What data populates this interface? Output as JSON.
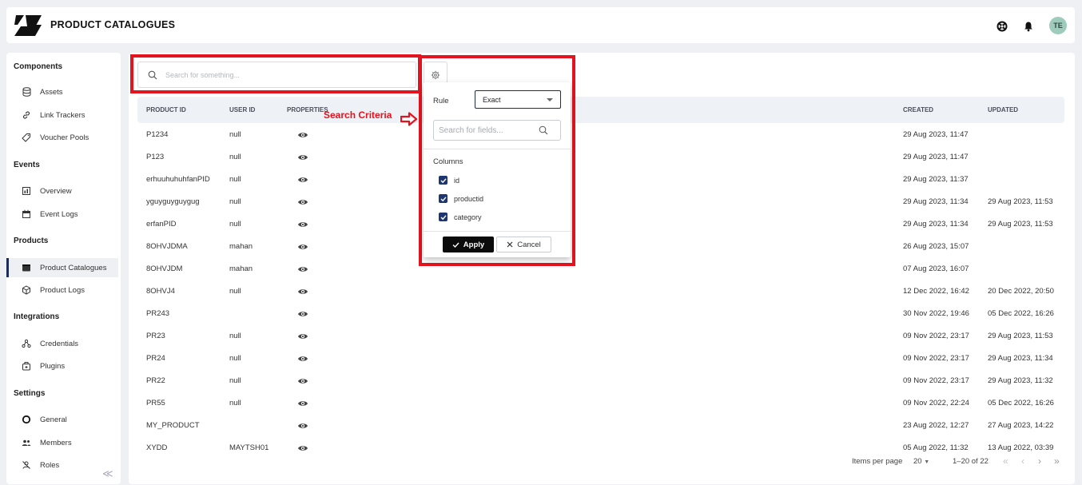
{
  "header": {
    "title": "PRODUCT CATALOGUES",
    "avatar": "TE"
  },
  "sidebar": {
    "sections": [
      {
        "title": "Components",
        "items": [
          "Assets",
          "Link Trackers",
          "Voucher Pools"
        ]
      },
      {
        "title": "Events",
        "items": [
          "Overview",
          "Event Logs"
        ]
      },
      {
        "title": "Products",
        "items": [
          "Product Catalogues",
          "Product Logs"
        ]
      },
      {
        "title": "Integrations",
        "items": [
          "Credentials",
          "Plugins"
        ]
      },
      {
        "title": "Settings",
        "items": [
          "General",
          "Members",
          "Roles"
        ]
      }
    ],
    "active_item": "Product Catalogues",
    "collapse_glyph": "≪"
  },
  "search": {
    "placeholder": "Search for something...",
    "value": ""
  },
  "table": {
    "columns": {
      "product_id": "PRODUCT ID",
      "user_id": "USER ID",
      "properties": "PROPERTIES",
      "created": "CREATED",
      "updated": "UPDATED"
    },
    "rows": [
      {
        "product_id": "P1234",
        "user_id": "null",
        "created": "29 Aug 2023, 11:47",
        "updated": ""
      },
      {
        "product_id": "P123",
        "user_id": "null",
        "created": "29 Aug 2023, 11:47",
        "updated": ""
      },
      {
        "product_id": "erhuuhuhuhfanPID",
        "user_id": "null",
        "created": "29 Aug 2023, 11:37",
        "updated": ""
      },
      {
        "product_id": "yguyguyguygug",
        "user_id": "null",
        "created": "29 Aug 2023, 11:34",
        "updated": "29 Aug 2023, 11:53"
      },
      {
        "product_id": "erfanPID",
        "user_id": "null",
        "created": "29 Aug 2023, 11:34",
        "updated": "29 Aug 2023, 11:53"
      },
      {
        "product_id": "8OHVJDMA",
        "user_id": "mahan",
        "created": "26 Aug 2023, 15:07",
        "updated": ""
      },
      {
        "product_id": "8OHVJDM",
        "user_id": "mahan",
        "created": "07 Aug 2023, 16:07",
        "updated": ""
      },
      {
        "product_id": "8OHVJ4",
        "user_id": "null",
        "created": "12 Dec 2022, 16:42",
        "updated": "20 Dec 2022, 20:50"
      },
      {
        "product_id": "PR243",
        "user_id": "",
        "created": "30 Nov 2022, 19:46",
        "updated": "05 Dec 2022, 16:26"
      },
      {
        "product_id": "PR23",
        "user_id": "null",
        "created": "09 Nov 2022, 23:17",
        "updated": "29 Aug 2023, 11:53"
      },
      {
        "product_id": "PR24",
        "user_id": "null",
        "created": "09 Nov 2022, 23:17",
        "updated": "29 Aug 2023, 11:34"
      },
      {
        "product_id": "PR22",
        "user_id": "null",
        "created": "09 Nov 2022, 23:17",
        "updated": "29 Aug 2023, 11:32"
      },
      {
        "product_id": "PR55",
        "user_id": "null",
        "created": "09 Nov 2022, 22:24",
        "updated": "05 Dec 2022, 16:26"
      },
      {
        "product_id": "MY_PRODUCT",
        "user_id": "",
        "created": "23 Aug 2022, 12:27",
        "updated": "27 Aug 2023, 14:22"
      },
      {
        "product_id": "XYDD",
        "user_id": "MAYTSH01",
        "created": "05 Aug 2022, 11:32",
        "updated": "13 Aug 2022, 03:39"
      }
    ]
  },
  "pagination": {
    "label": "Items per page",
    "per_page": "20",
    "range": "1–20 of 22"
  },
  "filter_popover": {
    "rule_label": "Rule",
    "rule_value": "Exact",
    "field_search_placeholder": "Search for fields...",
    "columns_label": "Columns",
    "columns": [
      {
        "label": "id",
        "checked": true
      },
      {
        "label": "productid",
        "checked": true
      },
      {
        "label": "category",
        "checked": true
      }
    ],
    "apply_label": "Apply",
    "cancel_label": "Cancel"
  },
  "annotation": {
    "text": "Search Criteria"
  },
  "colors": {
    "highlight": "#e3141f",
    "nav_active": "#1d2b5a",
    "checkbox": "#1d3570"
  }
}
